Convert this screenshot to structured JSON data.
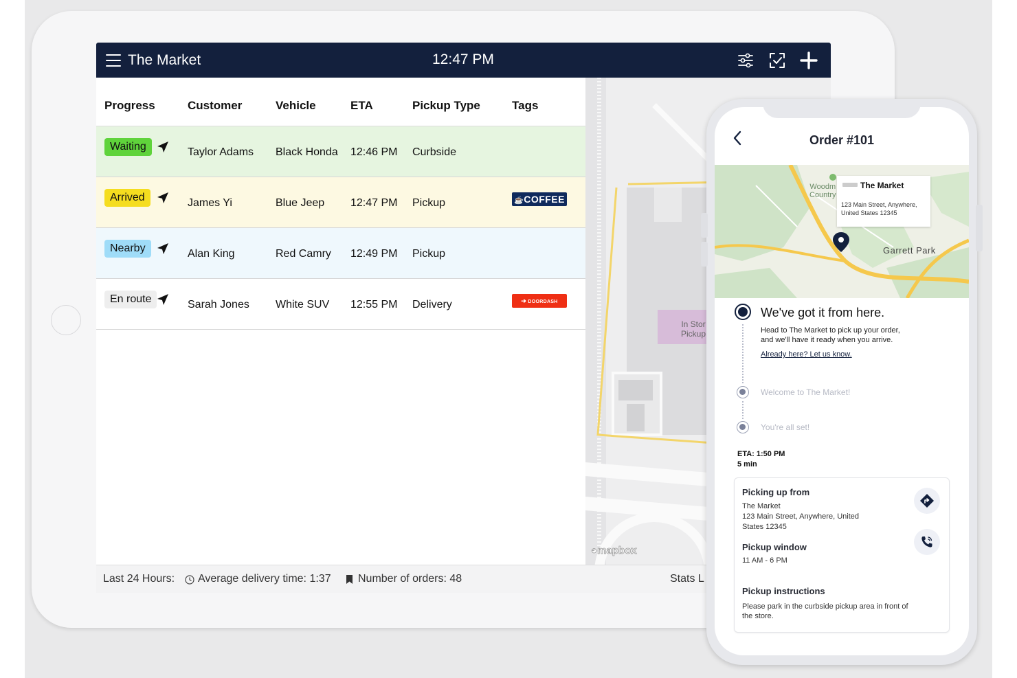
{
  "tablet": {
    "app_title": "The Market",
    "time": "12:47 PM",
    "icons": [
      "menu-icon",
      "filter-sliders-icon",
      "scan-check-icon",
      "plus-icon"
    ],
    "columns": [
      "Progress",
      "Customer",
      "Vehicle",
      "ETA",
      "Pickup Type",
      "Tags"
    ],
    "rows": [
      {
        "status": "Waiting",
        "status_color": "#5fd33b",
        "row_color": "#e6f5e0",
        "customer": "Taylor Adams",
        "vehicle": "Black Honda",
        "eta": "12:46 PM",
        "pickup_type": "Curbside",
        "tag": ""
      },
      {
        "status": "Arrived",
        "status_color": "#f5dd1f",
        "row_color": "#fdf9e2",
        "customer": "James Yi",
        "vehicle": "Blue Jeep",
        "eta": "12:47 PM",
        "pickup_type": "Pickup",
        "tag": "COFFEE"
      },
      {
        "status": "Nearby",
        "status_color": "#9fdcf8",
        "row_color": "#eff8fd",
        "customer": "Alan King",
        "vehicle": "Red Camry",
        "eta": "12:49 PM",
        "pickup_type": "Pickup",
        "tag": ""
      },
      {
        "status": "En route",
        "status_color": "#eeeeee",
        "row_color": "#ffffff",
        "customer": "Sarah Jones",
        "vehicle": "White SUV",
        "eta": "12:55 PM",
        "pickup_type": "Delivery",
        "tag": "DOORDASH"
      }
    ],
    "footer": {
      "period": "Last 24 Hours:",
      "avg_delivery": "Average delivery time: 1:37",
      "orders": "Number of orders: 48",
      "stats": "Stats L"
    },
    "map": {
      "store_label_1": "In Stor",
      "store_label_2": "Pickup",
      "attribution": "mapbox"
    }
  },
  "phone": {
    "title": "Order #101",
    "map": {
      "place_name": "The Market",
      "place_address_1": "123 Main Street, Anywhere,",
      "place_address_2": "United States 12345",
      "label_garrett": "Garrett Park",
      "label_wood_1": "Woodm",
      "label_wood_2": "Country"
    },
    "steps": {
      "current_title": "We've got it from here.",
      "current_desc_1": "Head to The Market to pick up your order,",
      "current_desc_2": "and we'll have it ready when you arrive.",
      "current_link": "Already here? Let us know.",
      "step2": "Welcome to The Market!",
      "step3": "You're all set!"
    },
    "eta": "ETA: 1:50 PM",
    "eta_mins": "5 min",
    "card": {
      "pickup_from_title": "Picking up from",
      "store": "The Market",
      "address_1": "123 Main Street, Anywhere, United",
      "address_2": "States 12345",
      "window_title": "Pickup window",
      "window": "11 AM - 6 PM",
      "instructions_title": "Pickup instructions",
      "instructions_1": "Please park in the curbside pickup area in front of",
      "instructions_2": "the store."
    },
    "accent": "#13203d"
  }
}
